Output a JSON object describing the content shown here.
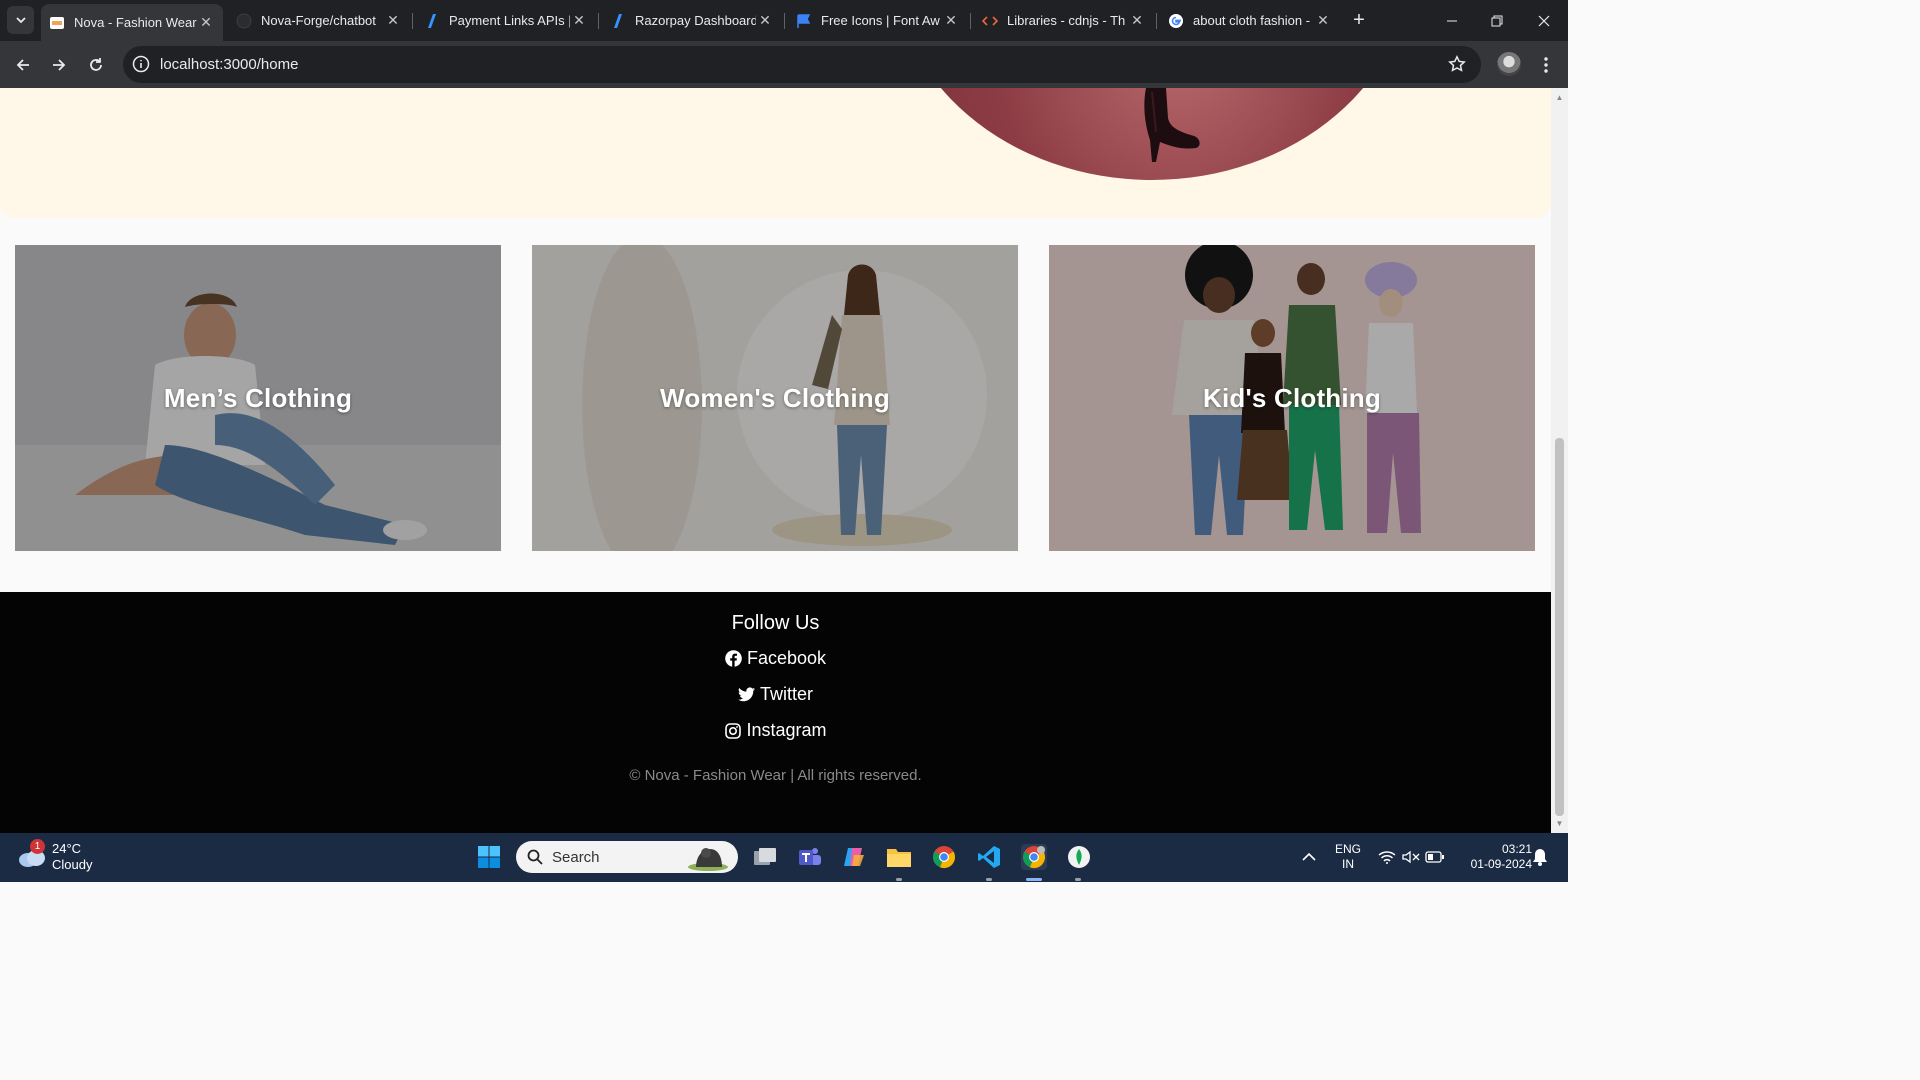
{
  "browser": {
    "tabs": [
      {
        "title": "Nova - Fashion Wear",
        "active": true,
        "icon": "nova-favicon"
      },
      {
        "title": "Nova-Forge/chatbot",
        "active": false,
        "icon": "github-icon"
      },
      {
        "title": "Payment Links APIs |",
        "active": false,
        "icon": "razorpay-icon"
      },
      {
        "title": "Razorpay Dashboard",
        "active": false,
        "icon": "razorpay-icon"
      },
      {
        "title": "Free Icons | Font Aw",
        "active": false,
        "icon": "fontawesome-flag-icon"
      },
      {
        "title": "Libraries - cdnjs - Th",
        "active": false,
        "icon": "code-icon"
      },
      {
        "title": "about cloth fashion -",
        "active": false,
        "icon": "google-icon"
      }
    ],
    "url": "localhost:3000/home"
  },
  "page": {
    "categories": [
      {
        "label": "Men’s Clothing"
      },
      {
        "label": "Women's Clothing"
      },
      {
        "label": "Kid's Clothing"
      }
    ],
    "footer": {
      "title": "Follow Us",
      "links": [
        {
          "label": "Facebook",
          "icon": "facebook-icon"
        },
        {
          "label": "Twitter",
          "icon": "twitter-icon"
        },
        {
          "label": "Instagram",
          "icon": "instagram-icon"
        }
      ],
      "copyright": "© Nova - Fashion Wear | All rights reserved."
    }
  },
  "taskbar": {
    "weather": {
      "badge": "1",
      "temp": "24°C",
      "condition": "Cloudy"
    },
    "search_placeholder": "Search",
    "language": {
      "line1": "ENG",
      "line2": "IN"
    },
    "clock": {
      "time": "03:21",
      "date": "01-09-2024"
    }
  },
  "colors": {
    "hero_bg": "#fff7e8",
    "footer_bg": "#040404",
    "taskbar_bg": "#1b2b44",
    "chrome_dark": "#202124"
  }
}
